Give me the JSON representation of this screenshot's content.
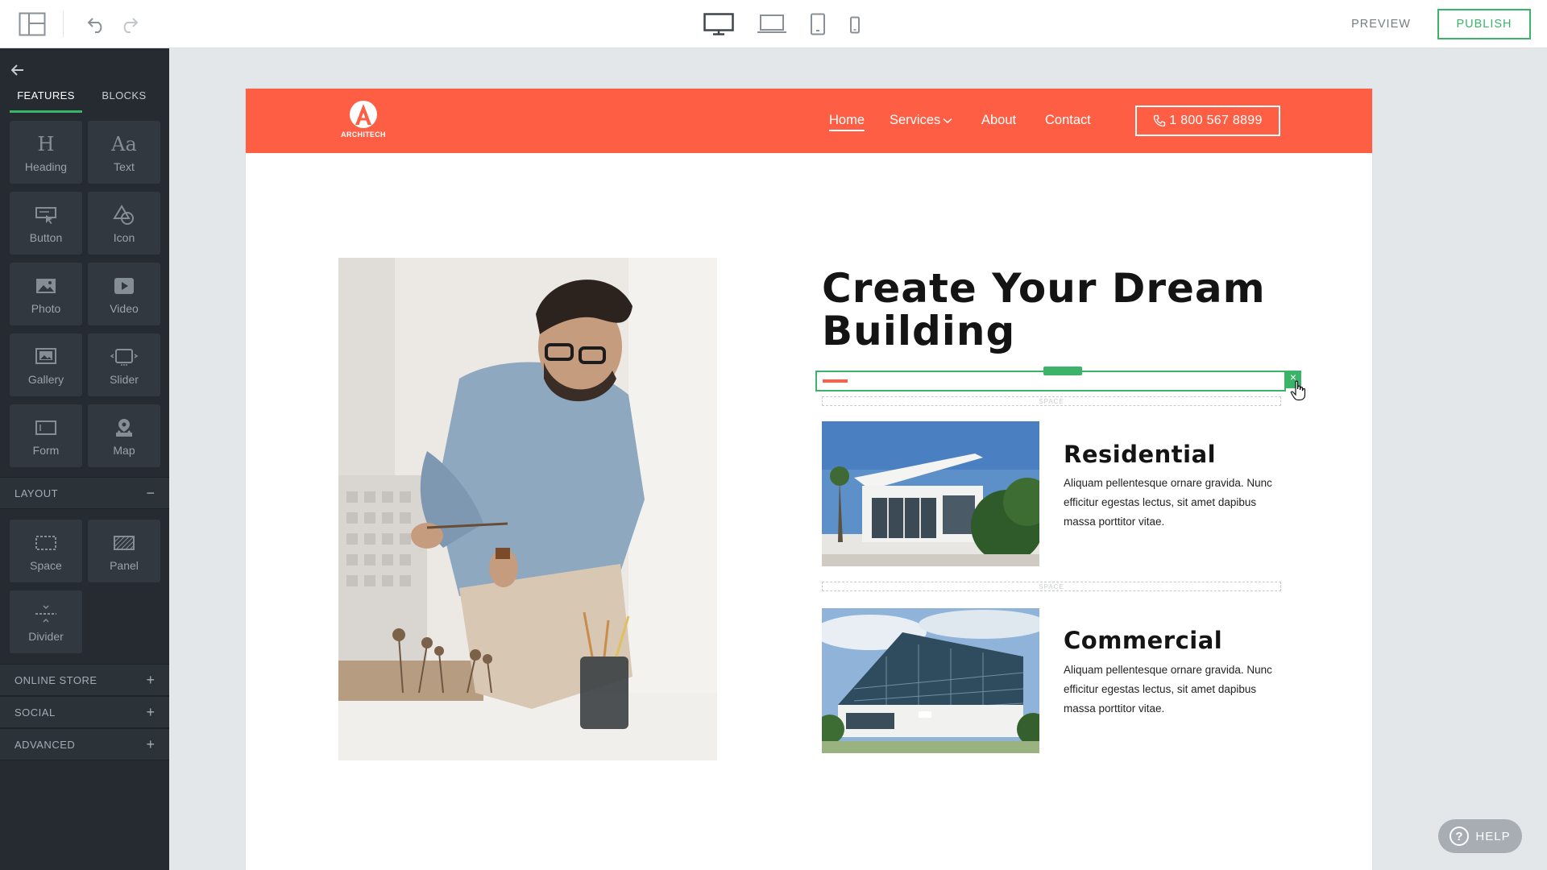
{
  "toolbar": {
    "preview_label": "PREVIEW",
    "publish_label": "PUBLISH",
    "icons": [
      "layout-icon",
      "undo-icon",
      "redo-icon",
      "desktop-icon",
      "laptop-icon",
      "tablet-icon",
      "phone-icon"
    ]
  },
  "sidebar": {
    "tabs": [
      {
        "label": "FEATURES",
        "active": true
      },
      {
        "label": "BLOCKS",
        "active": false
      }
    ],
    "features": [
      {
        "label": "Heading",
        "icon": "heading-icon",
        "glyph": "H"
      },
      {
        "label": "Text",
        "icon": "text-icon",
        "glyph": "Aa"
      },
      {
        "label": "Button",
        "icon": "button-icon"
      },
      {
        "label": "Icon",
        "icon": "shapes-icon"
      },
      {
        "label": "Photo",
        "icon": "photo-icon"
      },
      {
        "label": "Video",
        "icon": "video-icon"
      },
      {
        "label": "Gallery",
        "icon": "gallery-icon"
      },
      {
        "label": "Slider",
        "icon": "slider-icon"
      },
      {
        "label": "Form",
        "icon": "form-icon"
      },
      {
        "label": "Map",
        "icon": "map-pin-icon"
      }
    ],
    "layout": {
      "title": "LAYOUT",
      "toggle": "−",
      "items": [
        {
          "label": "Space",
          "icon": "space-icon"
        },
        {
          "label": "Panel",
          "icon": "panel-icon"
        },
        {
          "label": "Divider",
          "icon": "divider-icon"
        }
      ]
    },
    "sections": [
      {
        "title": "ONLINE STORE",
        "toggle": "+"
      },
      {
        "title": "SOCIAL",
        "toggle": "+"
      },
      {
        "title": "ADVANCED",
        "toggle": "+"
      }
    ]
  },
  "site": {
    "logo_text": "ARCHITECH",
    "nav": [
      "Home",
      "Services",
      "About",
      "Contact"
    ],
    "phone": "1 800 567 8899",
    "headline": "Create Your Dream Building",
    "space_label": "SPACE",
    "services": [
      {
        "title": "Residential",
        "text": "Aliquam pellentesque ornare gravida. Nunc efficitur egestas lectus, sit amet dapibus massa porttitor vitae."
      },
      {
        "title": "Commercial",
        "text": "Aliquam pellentesque ornare gravida. Nunc efficitur egestas lectus, sit amet dapibus massa porttitor vitae."
      }
    ]
  },
  "colors": {
    "accent_green": "#3bb46a",
    "brand_orange": "#fe5e43",
    "sidebar_bg": "#252b31"
  },
  "help": {
    "label": "HELP"
  }
}
